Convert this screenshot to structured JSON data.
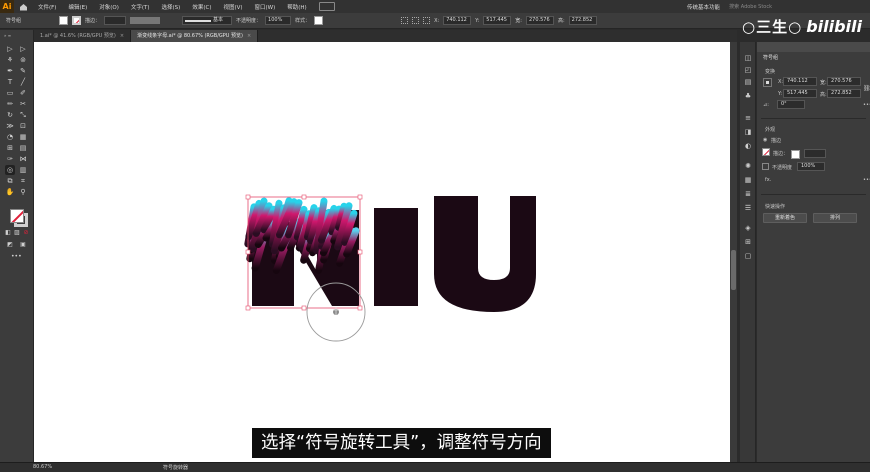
{
  "app": {
    "logo": "Ai"
  },
  "menu": [
    "文件(F)",
    "编辑(E)",
    "对象(O)",
    "文字(T)",
    "选择(S)",
    "效果(C)",
    "视图(V)",
    "窗口(W)",
    "帮助(H)"
  ],
  "workspace": "传统基本功能",
  "search_placeholder": "搜索 Adobe Stock",
  "control": {
    "stroke_label": "描边：",
    "brush_label": "基本",
    "opacity_label": "不透明度：",
    "opacity_value": "100%",
    "style_label": "样式：",
    "x_value": "740.112",
    "y_value": "517.445",
    "w_value": "270.576",
    "h_value": "272.852"
  },
  "tabs": [
    {
      "label": "1.ai* @ 41.6% (RGB/GPU 预览)",
      "close": "×"
    },
    {
      "label": "渐变线条字母.ai* @ 80.67% (RGB/GPU 预览)",
      "close": "×"
    }
  ],
  "panel": {
    "title": "符号组",
    "transform": {
      "title": "变换",
      "x_label": "X:",
      "x": "740.112",
      "y_label": "Y:",
      "y": "517.445",
      "w_label": "宽:",
      "w": "270.576",
      "h_label": "高:",
      "h": "272.852",
      "angle_label": "⊿:",
      "angle": "0°"
    },
    "appearance": {
      "title": "外观",
      "item": "描边",
      "stroke_label": "描边：",
      "opacity_label": "不透明度",
      "opacity_value": "100%",
      "fx_label": "fx."
    },
    "quick_actions": {
      "title": "快速操作",
      "btn_expand": "重新着色",
      "btn_arrange": "排列"
    }
  },
  "subtitle": "选择“符号旋转工具”，调整符号方向",
  "watermark": {
    "left": "○三生○",
    "right": "bilibili"
  },
  "status": {
    "zoom": "80.67%",
    "tool": "符号旋转器"
  },
  "colors": {
    "accent_cyan": "#27d3ea",
    "accent_magenta": "#d0186e",
    "dark_plum": "#2a0d22",
    "selection_red": "#e54b6b"
  }
}
